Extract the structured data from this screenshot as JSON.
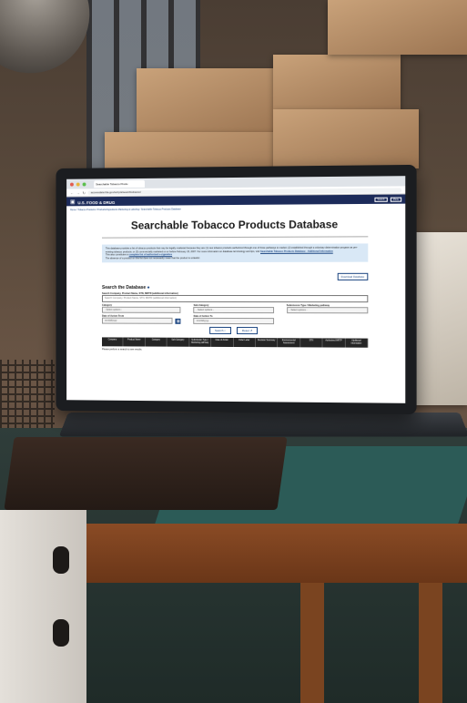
{
  "browser": {
    "tab_title": "Searchable Tobacco Produ",
    "url": "accessdata.fda.gov/scripts/searchtobacco/"
  },
  "agency": {
    "logo_text": "U.S. FOOD & DRUG",
    "logo_sub": "ADMINISTRATION",
    "search_label": "Search",
    "menu_label": "Menu"
  },
  "breadcrumbs": "Home / Tobacco Products / Products/Ingredients Marketing & Labeling / Searchable Tobacco Products Database",
  "page_title": "Searchable Tobacco Products Database",
  "info": {
    "paragraph": "This database provides a list of tobacco products that may be legally marketed because they are (1) new tobacco products authorized through one of three pathways to market; (2) established through a voluntary determination program as pre-existing tobacco products; or (3) commercially marketed on or before February 15, 2007. For more information on database terminology and tips, visit",
    "link1": "Searchable Tobacco Products Database - Additional Information",
    "line2_prefix": "This also constitutes a",
    "link2": "complete list of authorized e-cigarettes",
    "line3": "The absence of a product on this list does not necessarily mean that the product is unlawful."
  },
  "download_button": "Download Database",
  "search": {
    "heading": "Search the Database",
    "keyword_label": "Search Company, Product Name, STN, MDTR (additional information)",
    "keyword_placeholder": "Search Company, Product Name, STN, MDTR (additional information)",
    "category_label": "Category",
    "category_value": "- Select options -",
    "subcategory_label": "Sub-Category",
    "subcategory_value": "- Select options -",
    "pathway_label": "Submission Type / Marketing pathway",
    "pathway_value": "- Select options -",
    "date_from_label": "Date of Action From",
    "date_from_placeholder": "mm/dd/yyyy",
    "date_to_label": "Date of Action To",
    "date_to_placeholder": "mm/dd/yyyy",
    "search_button": "Search",
    "reset_button": "Reset"
  },
  "table": {
    "columns": [
      "Company",
      "Product Name",
      "Category",
      "Sub-Category",
      "Submission Type / Marketing pathway",
      "Date of Action",
      "Order Letter",
      "Decision Summary",
      "Environmental Assessment",
      "STN",
      "Authorized MRTP",
      "Additional Information"
    ]
  },
  "empty_message": "Please perform a search to see results."
}
